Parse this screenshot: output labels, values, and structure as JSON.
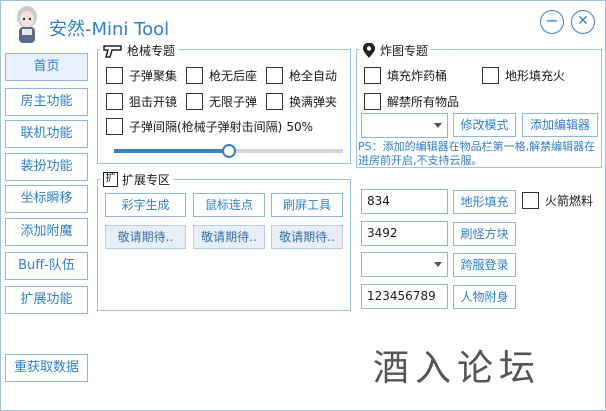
{
  "app": {
    "title": "安然-Mini Tool"
  },
  "window": {
    "minimize_label": "−",
    "close_label": "✕"
  },
  "nav": [
    {
      "label": "首页"
    },
    {
      "label": "房主功能"
    },
    {
      "label": "联机功能"
    },
    {
      "label": "装扮功能"
    },
    {
      "label": "坐标瞬移"
    },
    {
      "label": "添加附魔"
    },
    {
      "label": "Buff-队伍"
    },
    {
      "label": "扩展功能"
    }
  ],
  "refresh_button": "重获取数据",
  "gun_section": {
    "title": "枪械专题",
    "options": [
      "子弹聚集",
      "枪无后座",
      "枪全自动",
      "狙击开镜",
      "无限子弹",
      "换满弹夹",
      "子弹间隔(枪械子弹射击间隔)"
    ],
    "interval_value": "50%",
    "interval_level": 0.5
  },
  "bomb_section": {
    "title": "炸图专题",
    "options": [
      "填充炸药桶",
      "地形填充火",
      "解禁所有物品"
    ],
    "modify_mode_button": "修改模式",
    "add_editor_button": "添加编辑器",
    "note": "PS：添加的编辑器在物品栏第一格,解禁编辑器在进房前开启,不支持云服。"
  },
  "ext_section": {
    "title": "扩展专区",
    "buttons": [
      "彩字生成",
      "鼠标连点",
      "刷屏工具"
    ],
    "coming": [
      "敬请期待..",
      "敬请期待..",
      "敬请期待.."
    ]
  },
  "tools": {
    "terrain_value": "834",
    "terrain_button": "地形填充",
    "rocket_fuel": "火箭燃料",
    "monster_value": "3492",
    "monster_button": "刷怪方块",
    "cross_server_button": "跨服登录",
    "person_value": "123456789",
    "person_button": "人物附身"
  },
  "watermark": "酒入论坛",
  "colors": {
    "accent": "#2f7fd3",
    "border": "#8fb8e0"
  }
}
